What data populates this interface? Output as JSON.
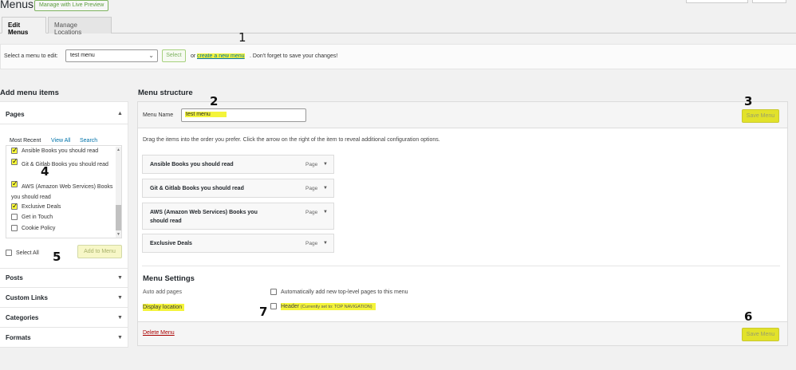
{
  "header": {
    "title": "Menus",
    "preview_button": "Manage with Live Preview"
  },
  "tabs": [
    {
      "label": "Edit Menus",
      "active": true
    },
    {
      "label": "Manage Locations",
      "active": false
    }
  ],
  "select_bar": {
    "label": "Select a menu to edit:",
    "selected_menu": "test menu",
    "select_button": "Select",
    "or_text": "or",
    "create_link": "create a new menu",
    "reminder": ". Don't forget to save your changes!"
  },
  "add_items": {
    "heading": "Add menu items",
    "sections": [
      "Pages",
      "Posts",
      "Custom Links",
      "Categories",
      "Formats"
    ],
    "pages_tabs": [
      "Most Recent",
      "View All",
      "Search"
    ],
    "pages": [
      {
        "label": "Ansible Books you should read",
        "checked": true
      },
      {
        "label": "Git & Gitlab Books you should read",
        "checked": true
      },
      {
        "label": "AWS (Amazon Web Services) Books you should read",
        "checked": true
      },
      {
        "label": "Exclusive Deals",
        "checked": true
      },
      {
        "label": "Get in Touch",
        "checked": false
      },
      {
        "label": "Cookie Policy",
        "checked": false
      }
    ],
    "select_all": "Select All",
    "add_button": "Add to Menu"
  },
  "structure": {
    "heading": "Menu structure",
    "menu_name_label": "Menu Name",
    "menu_name_value": "test menu",
    "save_button": "Save Menu",
    "instructions": "Drag the items into the order you prefer. Click the arrow on the right of the item to reveal additional configuration options.",
    "items": [
      {
        "title": "Ansible Books you should read",
        "type": "Page"
      },
      {
        "title": "Git & Gitlab Books you should read",
        "type": "Page"
      },
      {
        "title": "AWS (Amazon Web Services) Books you should read",
        "type": "Page"
      },
      {
        "title": "Exclusive Deals",
        "type": "Page"
      }
    ]
  },
  "settings": {
    "title": "Menu Settings",
    "auto_add_label": "Auto add pages",
    "auto_add_text": "Automatically add new top-level pages to this menu",
    "display_location_label": "Display location",
    "header_label": "Header",
    "header_note": "(Currently set to: TOP NAVIGATION)",
    "delete_link": "Delete Menu",
    "save_button": "Save Menu"
  },
  "annotations": [
    "1",
    "2",
    "3",
    "4",
    "5",
    "6",
    "7"
  ],
  "colors": {
    "highlight": "#f4f43a",
    "link": "#0073aa",
    "delete": "#aa0000"
  }
}
